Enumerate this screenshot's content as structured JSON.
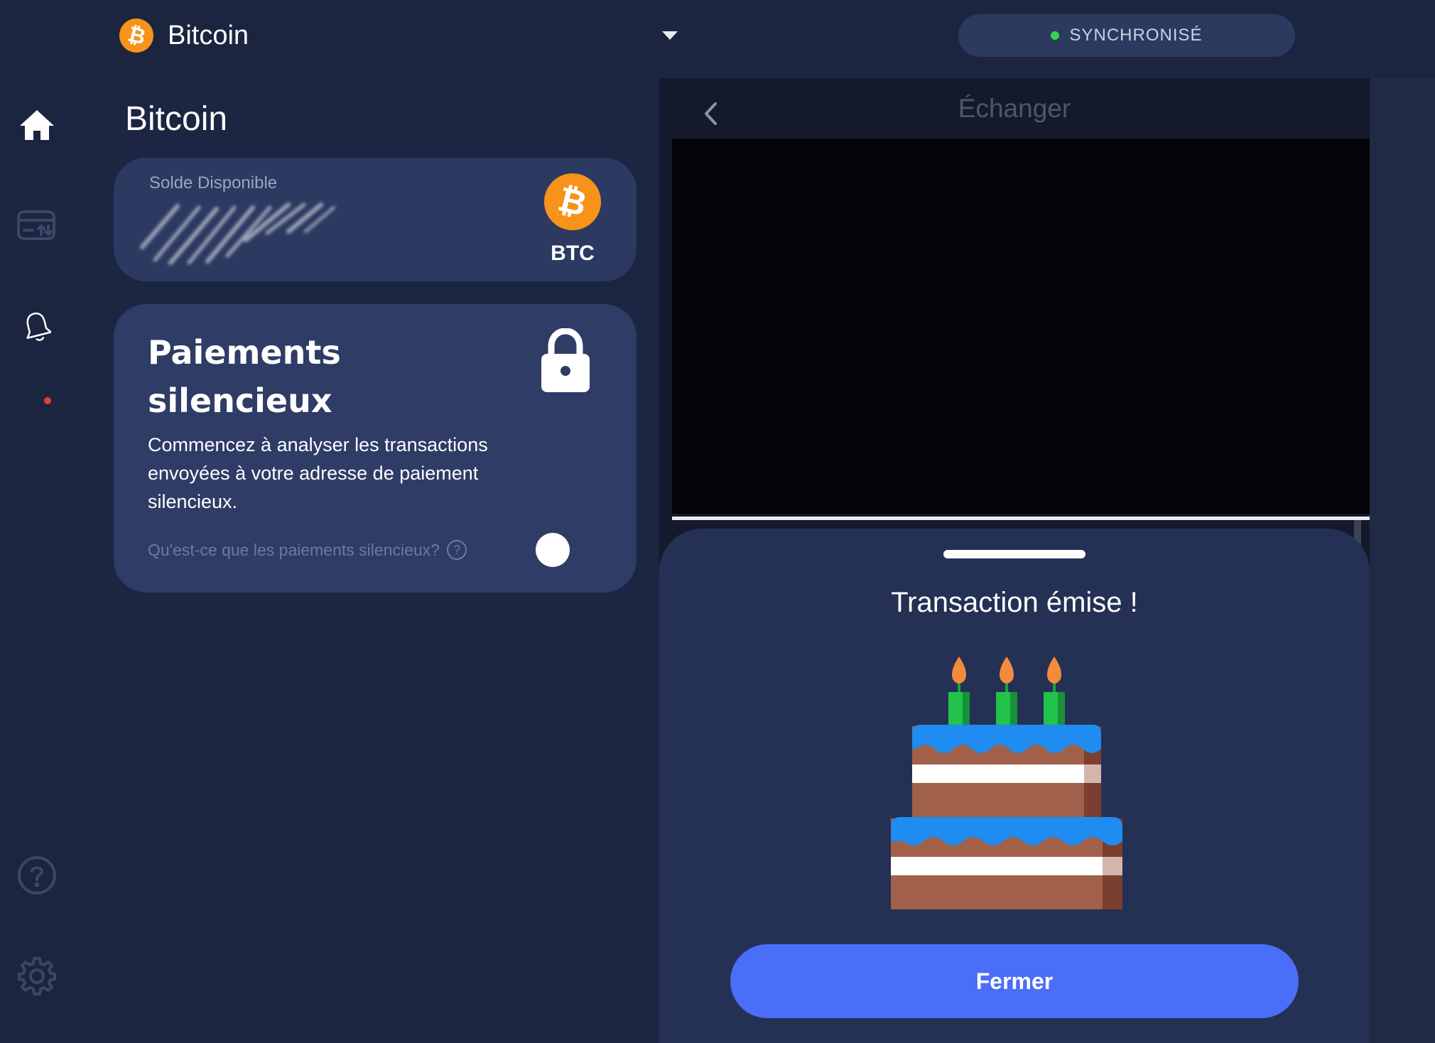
{
  "topbar": {
    "coin_symbol": "₿",
    "wallet_name": "Bitcoin",
    "sync_status": "SYNCHRONISÉ",
    "sync_color": "#32d74b"
  },
  "rail": {
    "items": [
      {
        "icon": "home-icon"
      },
      {
        "icon": "card-transfer-icon"
      },
      {
        "icon": "bell-icon",
        "badge_color": "#e93b3b"
      },
      {
        "icon": "help-icon"
      },
      {
        "icon": "gear-icon"
      }
    ]
  },
  "main": {
    "title": "Bitcoin",
    "balance": {
      "label": "Solde Disponible",
      "coin_symbol": "₿",
      "ticker": "BTC"
    },
    "silent_payments": {
      "title": "Paiements silencieux",
      "description": "Commencez à analyser les transactions envoyées à votre adresse de paiement silencieux.",
      "help_text": "Qu'est-ce que les paiements silencieux?",
      "help_symbol": "?",
      "enabled": false
    }
  },
  "exchange": {
    "title": "Échanger"
  },
  "sheet": {
    "title": "Transaction émise !",
    "close_label": "Fermer",
    "button_color": "#4a6ef8"
  },
  "colors": {
    "background": "#1b2540",
    "bitcoin_orange": "#f7931a",
    "card": "#2c3a62"
  }
}
